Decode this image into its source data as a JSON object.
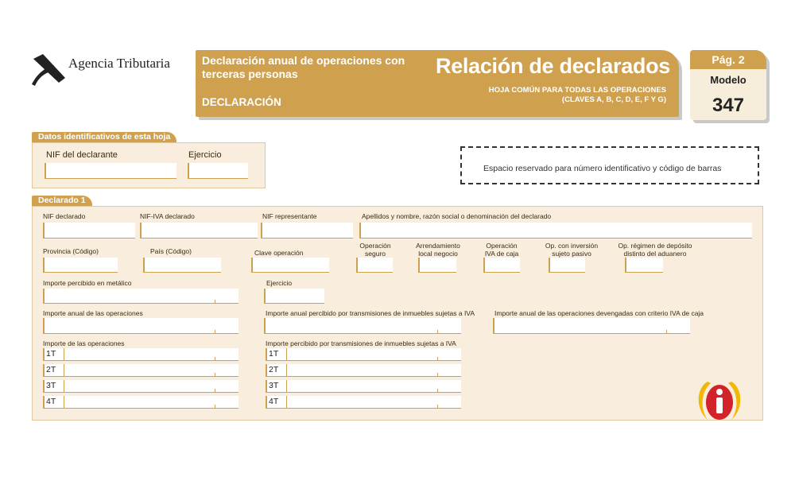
{
  "header": {
    "agency": "Agencia Tributaria",
    "form_title_line1": "Declaración anual de operaciones con",
    "form_title_line2": "terceras personas",
    "section": "DECLARACIÓN",
    "main_title": "Relación de declarados",
    "subtitle_line1": "HOJA COMÚN PARA TODAS LAS OPERACIONES",
    "subtitle_line2": "(CLAVES A, B, C, D, E, F Y G)",
    "page": "Pág. 2",
    "modelo_label": "Modelo",
    "modelo_number": "347"
  },
  "datos": {
    "tab": "Datos identificativos de esta hoja",
    "nif_label": "NIF del declarante",
    "ejercicio_label": "Ejercicio"
  },
  "barcode": {
    "text": "Espacio reservado para número identificativo y código de barras"
  },
  "declarado": {
    "tab": "Declarado 1",
    "nif": "NIF declarado",
    "nif_iva": "NIF-IVA declarado",
    "nif_rep": "NIF representante",
    "apellidos": "Apellidos y nombre, razón social o denominación del declarado",
    "provincia": "Provincia (Código)",
    "pais": "País (Código)",
    "clave": "Clave operación",
    "op_seguro_1": "Operación",
    "op_seguro_2": "seguro",
    "arrend_1": "Arrendamiento",
    "arrend_2": "local negocio",
    "op_iva_1": "Operación",
    "op_iva_2": "IVA de caja",
    "inversion_1": "Op. con inversión",
    "inversion_2": "sujeto pasivo",
    "regimen_1": "Op. régimen de depósito",
    "regimen_2": "distinto del aduanero",
    "importe_metalico": "Importe percibido en metálico",
    "ejercicio": "Ejercicio",
    "importe_anual": "Importe anual de las operaciones",
    "importe_anual_inmuebles": "Importe anual percibido por transmisiones de inmuebles sujetas a IVA",
    "importe_anual_caja": "Importe anual de las operaciones devengadas con criterio IVA de caja",
    "importe_ops": "Importe de las operaciones",
    "importe_inmuebles": "Importe percibido por transmisiones de inmuebles sujetas a IVA",
    "quarters": [
      "1T",
      "2T",
      "3T",
      "4T"
    ]
  },
  "colors": {
    "accent": "#cfa14f",
    "panel": "#f9eedd",
    "logo_red": "#d2232a",
    "logo_yellow": "#f2b705"
  }
}
